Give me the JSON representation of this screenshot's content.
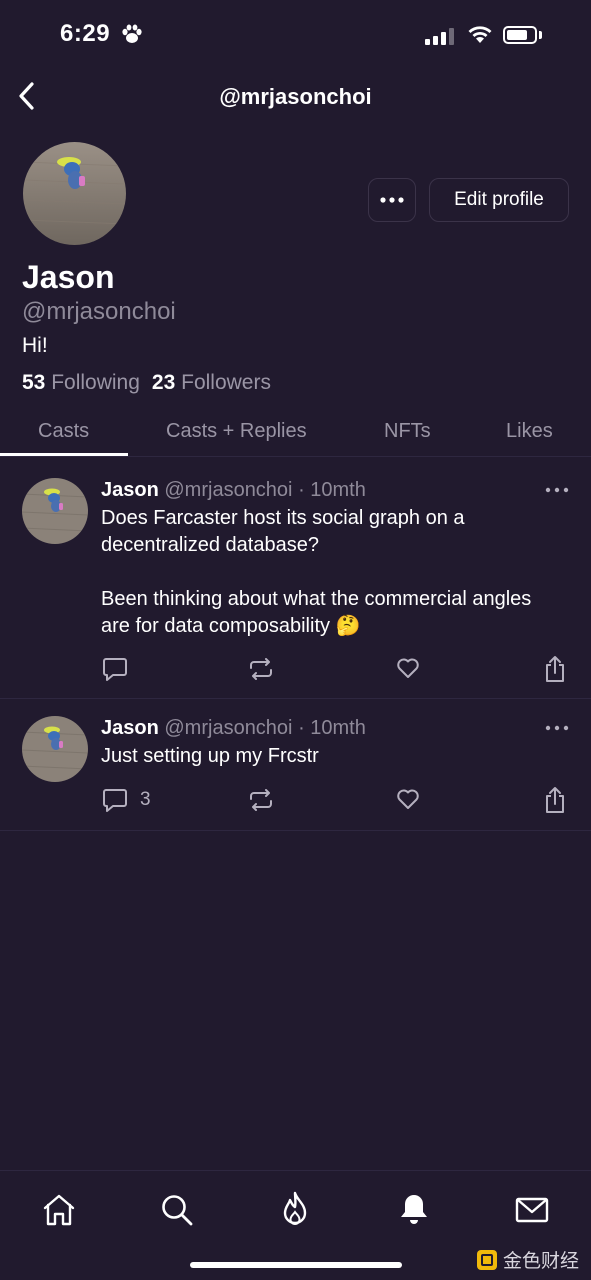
{
  "status_bar": {
    "time": "6:29"
  },
  "header": {
    "title": "@mrjasonchoi",
    "back_icon": "chevron-left-icon"
  },
  "profile": {
    "display_name": "Jason",
    "handle": "@mrjasonchoi",
    "bio": "Hi!",
    "following_count": "53",
    "following_label": "Following",
    "followers_count": "23",
    "followers_label": "Followers",
    "edit_profile_label": "Edit profile",
    "more_label": "•••"
  },
  "tabs": [
    {
      "label": "Casts",
      "active": true
    },
    {
      "label": "Casts + Replies",
      "active": false
    },
    {
      "label": "NFTs",
      "active": false
    },
    {
      "label": "Likes",
      "active": false
    }
  ],
  "posts": [
    {
      "author": "Jason",
      "handle": "@mrjasonchoi",
      "age": "· 10mth",
      "text_line1": "Does Farcaster host its social graph on a",
      "text_line2": "decentralized database?",
      "text_line3": "Been thinking about what the commercial angles",
      "text_line4": "are for data composability",
      "emoji": "🤔",
      "reply_count": ""
    },
    {
      "author": "Jason",
      "handle": "@mrjasonchoi",
      "age": "· 10mth",
      "text_line1": "Just setting up my Frcstr",
      "reply_count": "3"
    }
  ],
  "bottom_nav": [
    "home-icon",
    "search-icon",
    "flame-icon",
    "bell-icon",
    "mail-icon"
  ],
  "watermark": {
    "text": "金色财经"
  },
  "colors": {
    "background": "#211a2e",
    "divider": "#2e2740",
    "muted": "#8f8a99",
    "watermark_accent": "#f0b90b"
  }
}
